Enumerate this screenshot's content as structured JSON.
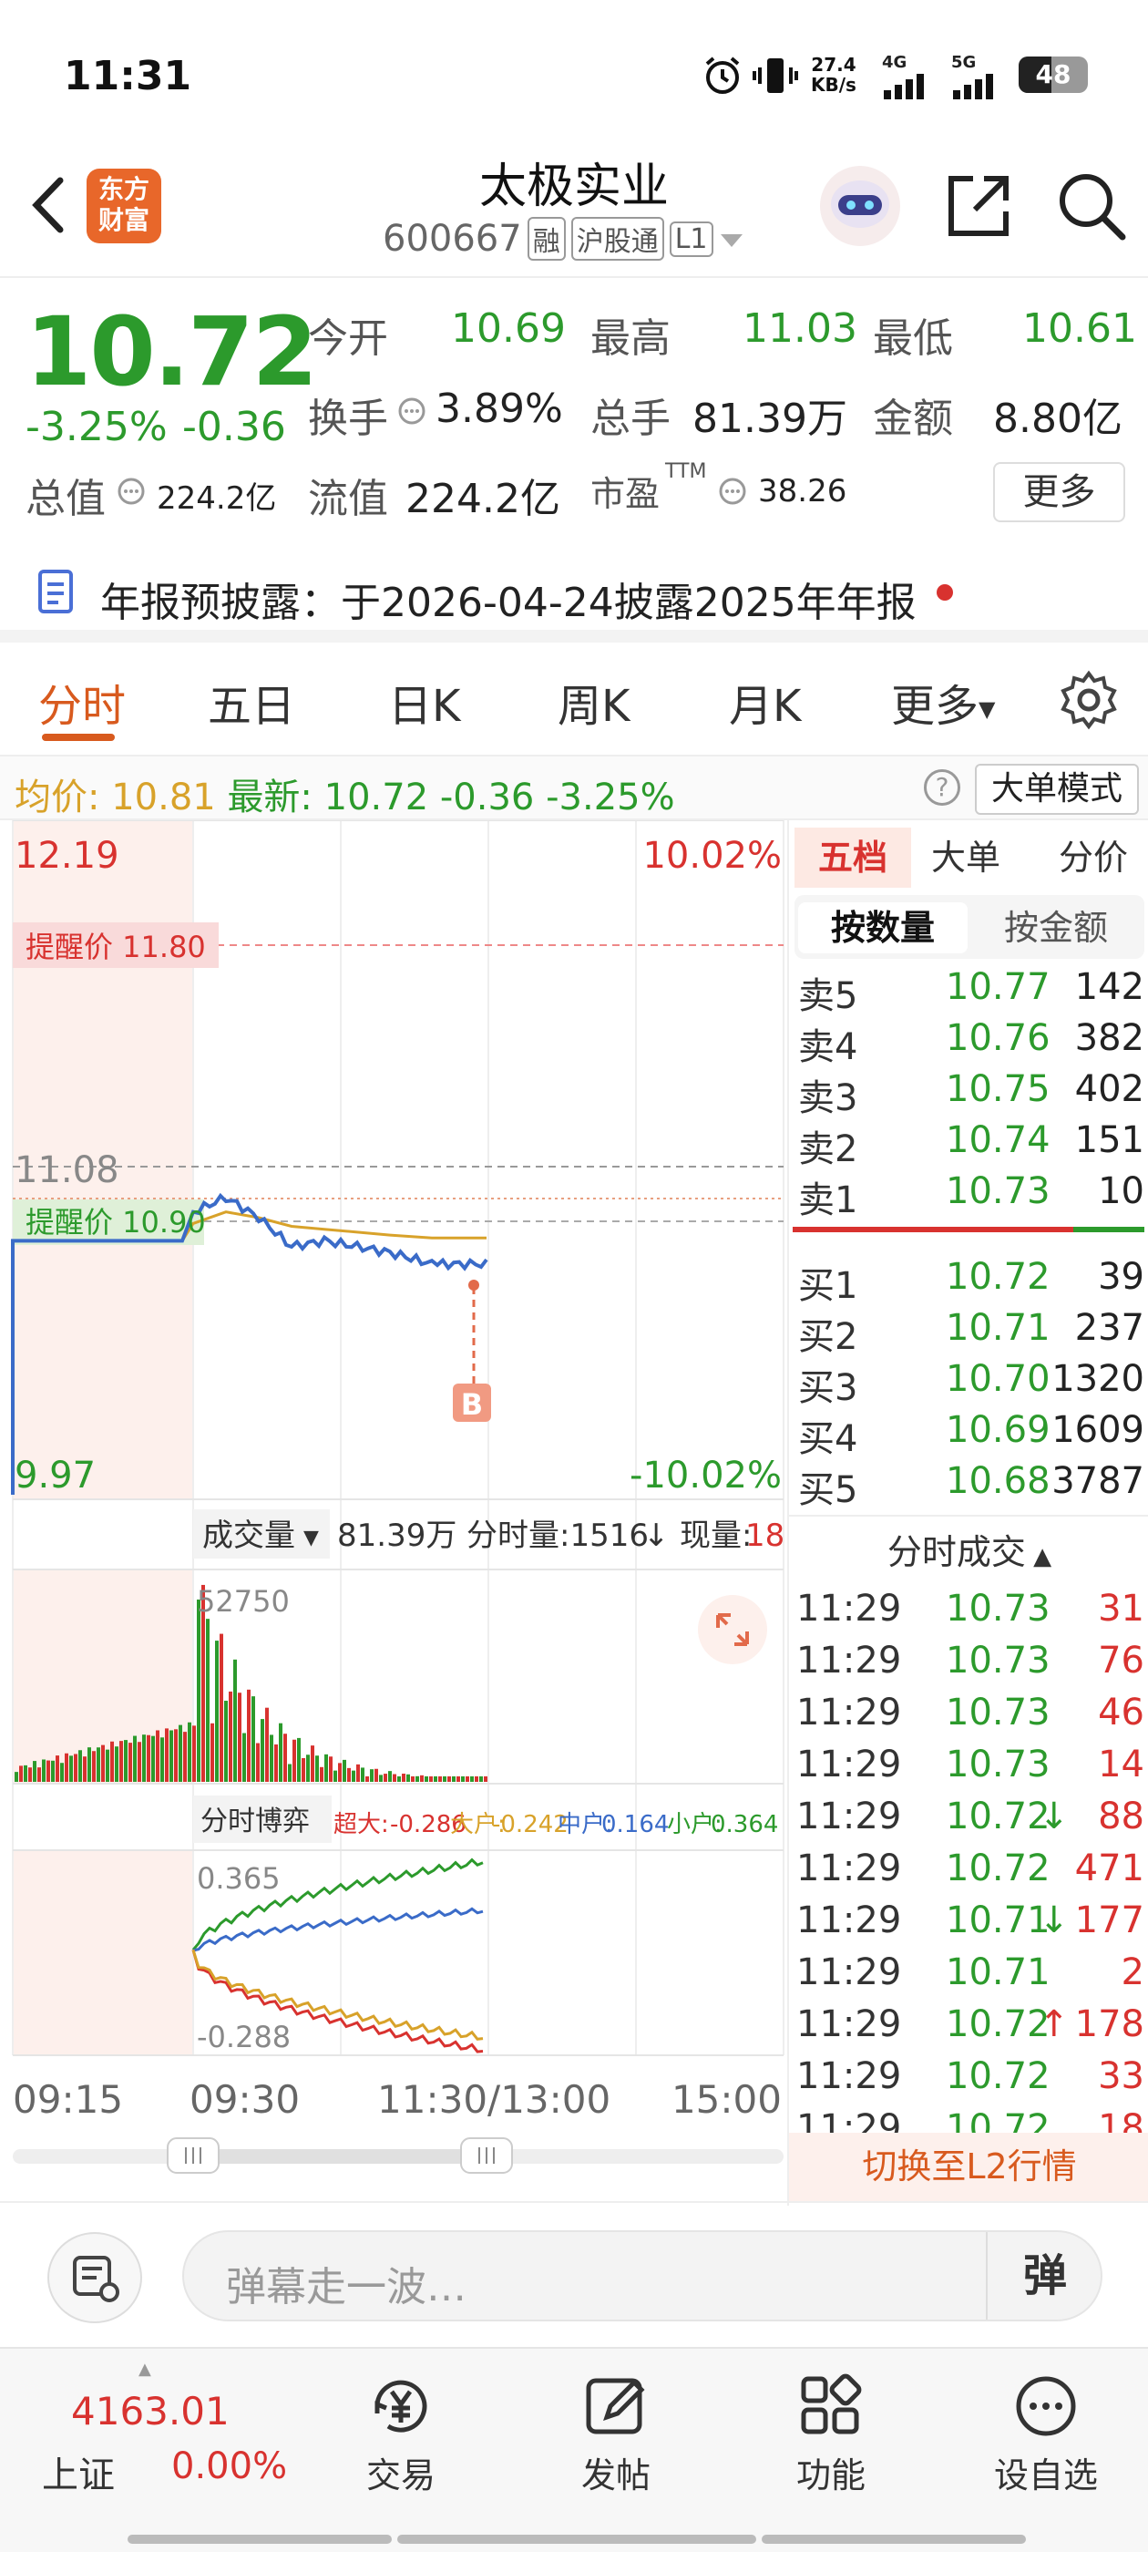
{
  "status": {
    "time": "11:31",
    "speed": "27.4",
    "speed_unit": "KB/s",
    "net1": "4G",
    "net2": "5G",
    "battery": "48"
  },
  "header": {
    "title": "太极实业",
    "code": "600667",
    "tag1": "融",
    "tag2": "沪股通",
    "tag3": "L1",
    "logo_line1": "东方",
    "logo_line2": "财富"
  },
  "quote": {
    "price": "10.72",
    "change_pct": "-3.25%",
    "change": "-0.36",
    "open_label": "今开",
    "open": "10.69",
    "high_label": "最高",
    "high": "11.03",
    "low_label": "最低",
    "low": "10.61",
    "turnover_label": "换手",
    "turnover": "3.89%",
    "volume_label": "总手",
    "volume": "81.39万",
    "amount_label": "金额",
    "amount": "8.80亿",
    "mktcap_label": "总值",
    "mktcap": "224.2亿",
    "float_label": "流值",
    "float": "224.2亿",
    "pe_label": "市盈",
    "pe_sup": "TTM",
    "pe": "38.26",
    "more": "更多"
  },
  "notice": {
    "text": "年报预披露：于2026-04-24披露2025年年报"
  },
  "tabs": [
    "分时",
    "五日",
    "日K",
    "周K",
    "月K",
    "更多"
  ],
  "infoline": {
    "avg_label": "均价:",
    "avg": "10.81",
    "last_label": "最新:",
    "last": "10.72",
    "chg": "-0.36",
    "pct": "-3.25%",
    "help": "?",
    "mode": "大单模式"
  },
  "chart": {
    "top_price": "12.19",
    "top_pct": "10.02%",
    "bottom_price": "9.97",
    "bottom_pct": "-10.02%",
    "ref_price": "11.08",
    "alert_high": "提醒价 11.80",
    "alert_low": "提醒价 10.90",
    "buy_marker": "B",
    "vol_label": "成交量",
    "vol_total": "81.39万",
    "vol_period": "分时量:1516",
    "vol_now_label": "现量:",
    "vol_now": "18",
    "vol_max": "52750",
    "flow_label": "分时博弈",
    "flow_super_label": "超大:",
    "flow_super": "-0.286",
    "flow_big_label": "大户:",
    "flow_big": "-0.242",
    "flow_mid_label": "中户:",
    "flow_mid": "0.164",
    "flow_small_label": "小户:",
    "flow_small": "0.364",
    "flow_top": "0.365",
    "flow_bottom": "-0.288",
    "time_labels": [
      "09:15",
      "09:30",
      "11:30/13:00",
      "15:00"
    ]
  },
  "chart_data": {
    "type": "line",
    "title": "",
    "xlabel": "",
    "ylabel": "",
    "ylim": [
      9.97,
      12.19
    ],
    "x": [
      "09:15",
      "09:25",
      "09:30",
      "09:45",
      "10:00",
      "10:15",
      "10:30",
      "10:45",
      "11:00",
      "11:15",
      "11:29"
    ],
    "series": [
      {
        "name": "最新",
        "values": [
          10.8,
          10.8,
          10.9,
          10.95,
          10.88,
          10.78,
          10.8,
          10.78,
          10.76,
          10.72,
          10.72
        ]
      },
      {
        "name": "均价",
        "values": [
          10.8,
          10.8,
          10.86,
          10.9,
          10.88,
          10.85,
          10.84,
          10.83,
          10.82,
          10.81,
          10.81
        ]
      }
    ]
  },
  "rpanel": {
    "tabs": [
      "五档",
      "大单",
      "分价"
    ],
    "subtabs": [
      "按数量",
      "按金额"
    ],
    "asks": [
      {
        "label": "卖5",
        "price": "10.77",
        "vol": "142"
      },
      {
        "label": "卖4",
        "price": "10.76",
        "vol": "382"
      },
      {
        "label": "卖3",
        "price": "10.75",
        "vol": "402"
      },
      {
        "label": "卖2",
        "price": "10.74",
        "vol": "151"
      },
      {
        "label": "卖1",
        "price": "10.73",
        "vol": "10"
      }
    ],
    "bids": [
      {
        "label": "买1",
        "price": "10.72",
        "vol": "39"
      },
      {
        "label": "买2",
        "price": "10.71",
        "vol": "237"
      },
      {
        "label": "买3",
        "price": "10.70",
        "vol": "1320"
      },
      {
        "label": "买4",
        "price": "10.69",
        "vol": "1609"
      },
      {
        "label": "买5",
        "price": "10.68",
        "vol": "3787"
      }
    ],
    "trades_title": "分时成交",
    "trades": [
      {
        "time": "11:29",
        "price": "10.73",
        "arrow": "",
        "vol": "31"
      },
      {
        "time": "11:29",
        "price": "10.73",
        "arrow": "",
        "vol": "76"
      },
      {
        "time": "11:29",
        "price": "10.73",
        "arrow": "",
        "vol": "46"
      },
      {
        "time": "11:29",
        "price": "10.73",
        "arrow": "",
        "vol": "14"
      },
      {
        "time": "11:29",
        "price": "10.72",
        "arrow": "↓",
        "vol": "88"
      },
      {
        "time": "11:29",
        "price": "10.72",
        "arrow": "",
        "vol": "471"
      },
      {
        "time": "11:29",
        "price": "10.71",
        "arrow": "↓",
        "vol": "177"
      },
      {
        "time": "11:29",
        "price": "10.71",
        "arrow": "",
        "vol": "2"
      },
      {
        "time": "11:29",
        "price": "10.72",
        "arrow": "↑",
        "vol": "178"
      },
      {
        "time": "11:29",
        "price": "10.72",
        "arrow": "",
        "vol": "33"
      },
      {
        "time": "11:29",
        "price": "10.72",
        "arrow": "",
        "vol": "18"
      }
    ],
    "l2_button": "切换至L2行情"
  },
  "inputbar": {
    "placeholder": "弹幕走一波…",
    "dan": "弹"
  },
  "bottomnav": {
    "index_value": "4163.01",
    "index_name": "上证",
    "index_pct": "0.00%",
    "items": [
      "交易",
      "发帖",
      "功能",
      "设自选"
    ]
  }
}
